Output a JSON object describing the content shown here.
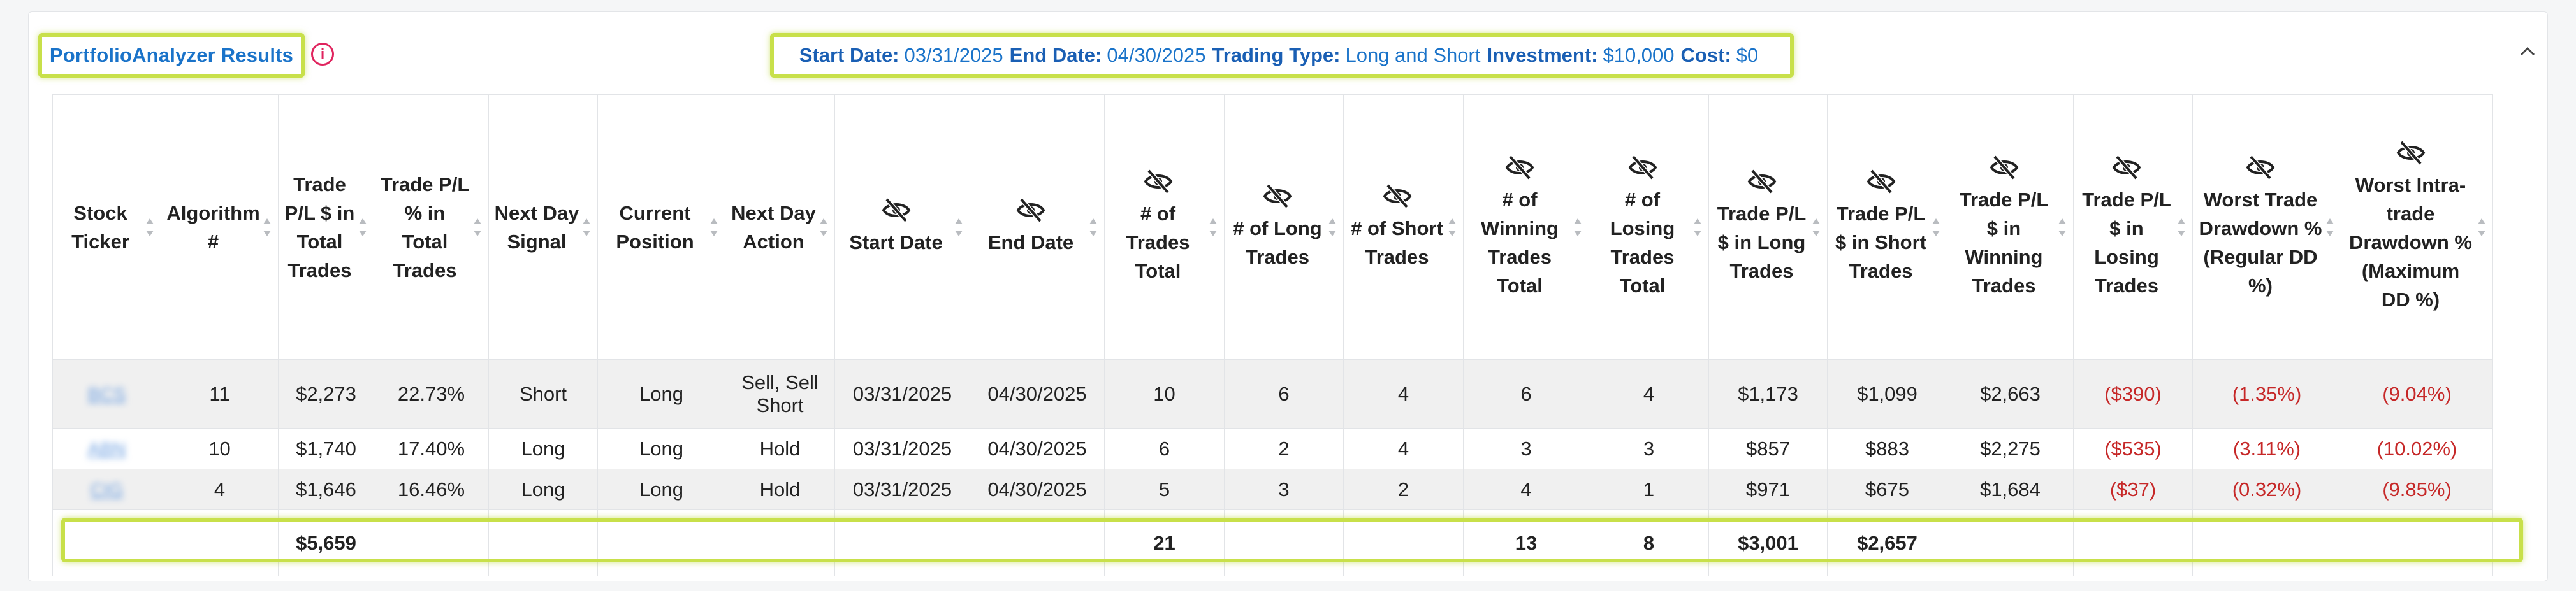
{
  "header": {
    "title": "PortfolioAnalyzer Results",
    "info_icon": "info-icon",
    "params": [
      {
        "label": "Start Date:",
        "value": "03/31/2025"
      },
      {
        "label": "End Date:",
        "value": "04/30/2025"
      },
      {
        "label": "Trading Type:",
        "value": "Long and Short"
      },
      {
        "label": "Investment:",
        "value": "$10,000"
      },
      {
        "label": "Cost:",
        "value": "$0"
      }
    ],
    "collapse_icon": "chevron-up-icon"
  },
  "table": {
    "columns": [
      {
        "label": "Stock Ticker",
        "hidden_icon": false
      },
      {
        "label": "Algorithm #",
        "hidden_icon": false
      },
      {
        "label": "Trade P/L $ in Total Trades",
        "hidden_icon": false
      },
      {
        "label": "Trade P/L % in Total Trades",
        "hidden_icon": false
      },
      {
        "label": "Next Day Signal",
        "hidden_icon": false
      },
      {
        "label": "Current Position",
        "hidden_icon": false
      },
      {
        "label": "Next Day Action",
        "hidden_icon": false
      },
      {
        "label": "Start Date",
        "hidden_icon": true
      },
      {
        "label": "End Date",
        "hidden_icon": true
      },
      {
        "label": "# of Trades Total",
        "hidden_icon": true
      },
      {
        "label": "# of Long Trades",
        "hidden_icon": true
      },
      {
        "label": "# of Short Trades",
        "hidden_icon": true
      },
      {
        "label": "# of Winning Trades Total",
        "hidden_icon": true
      },
      {
        "label": "# of Losing Trades Total",
        "hidden_icon": true
      },
      {
        "label": "Trade P/L $ in Long Trades",
        "hidden_icon": true
      },
      {
        "label": "Trade P/L $ in Short Trades",
        "hidden_icon": true
      },
      {
        "label": "Trade P/L $ in Winning Trades",
        "hidden_icon": true
      },
      {
        "label": "Trade P/L $ in Losing Trades",
        "hidden_icon": true
      },
      {
        "label": "Worst Trade Drawdown % (Regular DD %)",
        "hidden_icon": true
      },
      {
        "label": "Worst Intra-trade Drawdown % (Maximum DD %)",
        "hidden_icon": true
      }
    ],
    "rows": [
      [
        "BCS",
        "11",
        "$2,273",
        "22.73%",
        "Short",
        "Long",
        "Sell, Sell Short",
        "03/31/2025",
        "04/30/2025",
        "10",
        "6",
        "4",
        "6",
        "4",
        "$1,173",
        "$1,099",
        "$2,663",
        "($390)",
        "(1.35%)",
        "(9.04%)"
      ],
      [
        "ABN",
        "10",
        "$1,740",
        "17.40%",
        "Long",
        "Long",
        "Hold",
        "03/31/2025",
        "04/30/2025",
        "6",
        "2",
        "4",
        "3",
        "3",
        "$857",
        "$883",
        "$2,275",
        "($535)",
        "(3.11%)",
        "(10.02%)"
      ],
      [
        "CIG",
        "4",
        "$1,646",
        "16.46%",
        "Long",
        "Long",
        "Hold",
        "03/31/2025",
        "04/30/2025",
        "5",
        "3",
        "2",
        "4",
        "1",
        "$971",
        "$675",
        "$1,684",
        "($37)",
        "(0.32%)",
        "(9.85%)"
      ]
    ],
    "totals": [
      "",
      "",
      "$5,659",
      "",
      "",
      "",
      "",
      "",
      "",
      "21",
      "",
      "",
      "13",
      "8",
      "$3,001",
      "$2,657",
      "",
      "",
      "",
      ""
    ],
    "negative_color": "#c62828"
  }
}
